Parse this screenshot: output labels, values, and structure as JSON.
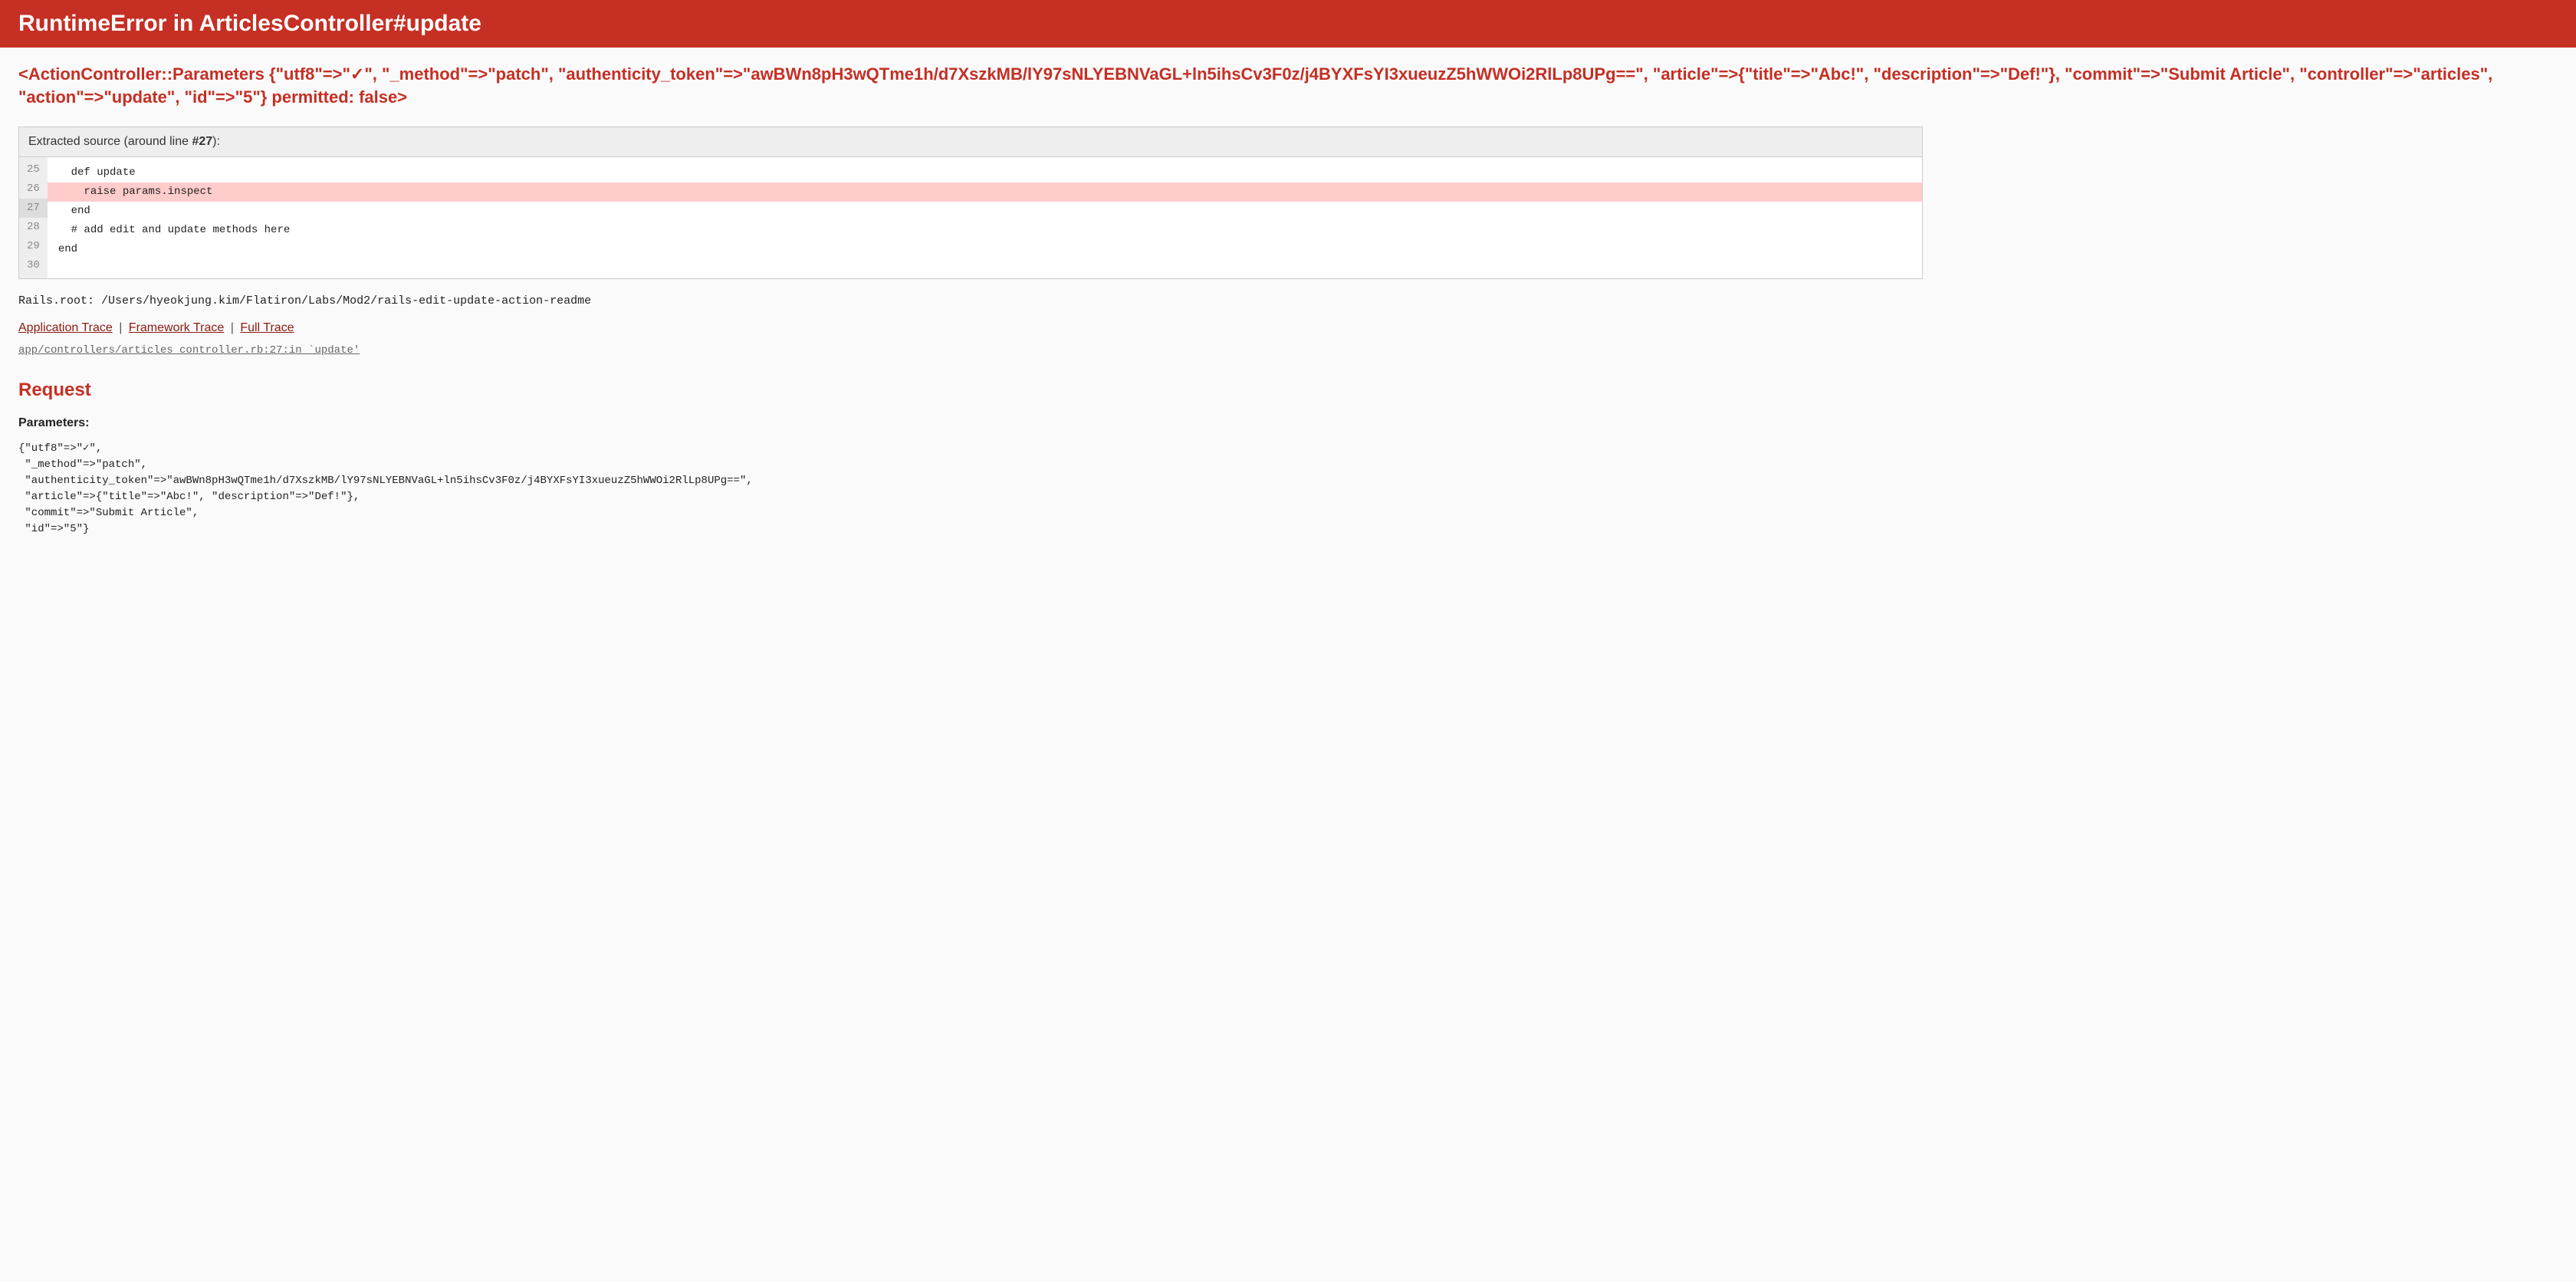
{
  "header": {
    "title": "RuntimeError in ArticlesController#update"
  },
  "exception": {
    "message": "<ActionController::Parameters {\"utf8\"=>\"✓\", \"_method\"=>\"patch\", \"authenticity_token\"=>\"awBWn8pH3wQTme1h/d7XszkMB/lY97sNLYEBNVaGL+ln5ihsCv3F0z/j4BYXFsYI3xueuzZ5hWWOi2RlLp8UPg==\", \"article\"=>{\"title\"=>\"Abc!\", \"description\"=>\"Def!\"}, \"commit\"=>\"Submit Article\", \"controller\"=>\"articles\", \"action\"=>\"update\", \"id\"=>\"5\"} permitted: false>"
  },
  "source": {
    "label": "Extracted source (around line ",
    "line_num": "#27",
    "label_end": "):",
    "lines": [
      {
        "num": "25",
        "code": ""
      },
      {
        "num": "26",
        "code": "  def update"
      },
      {
        "num": "27",
        "code": "    raise params.inspect"
      },
      {
        "num": "28",
        "code": "  end"
      },
      {
        "num": "29",
        "code": "  # add edit and update methods here"
      },
      {
        "num": "30",
        "code": "end"
      }
    ]
  },
  "rails_root": "Rails.root: /Users/hyeokjung.kim/Flatiron/Labs/Mod2/rails-edit-update-action-readme",
  "trace_links": {
    "app": "Application Trace",
    "framework": "Framework Trace",
    "full": "Full Trace"
  },
  "trace_line": "app/controllers/articles_controller.rb:27:in `update'",
  "request": {
    "heading": "Request",
    "param_label": "Parameters",
    "colon": ":",
    "dump": "{\"utf8\"=>\"✓\",\n \"_method\"=>\"patch\",\n \"authenticity_token\"=>\"awBWn8pH3wQTme1h/d7XszkMB/lY97sNLYEBNVaGL+ln5ihsCv3F0z/j4BYXFsYI3xueuzZ5hWWOi2RlLp8UPg==\",\n \"article\"=>{\"title\"=>\"Abc!\", \"description\"=>\"Def!\"},\n \"commit\"=>\"Submit Article\",\n \"id\"=>\"5\"}"
  }
}
